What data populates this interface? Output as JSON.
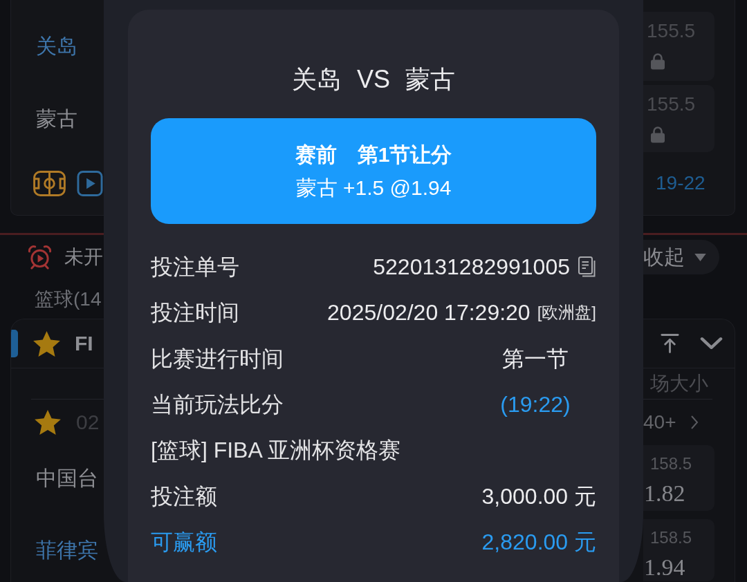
{
  "background": {
    "match": {
      "teams": [
        {
          "name": "关岛",
          "highlighted": true,
          "line": "155.5",
          "locked": true
        },
        {
          "name": "蒙古",
          "highlighted": false,
          "line": "155.5",
          "locked": true
        }
      ],
      "score": "19-22"
    },
    "status_bar": {
      "label": "未开",
      "collapse_button": "收起"
    },
    "section_title": "篮球(14",
    "league": {
      "name": "FI",
      "starred": true,
      "market": "场大小",
      "match": {
        "starred": true,
        "date": "02",
        "more": "40+",
        "teams": [
          {
            "name": "中国台",
            "highlighted": false,
            "line": "158.5",
            "odds": "1.82"
          },
          {
            "name": "菲律宾",
            "highlighted": true,
            "line": "158.5",
            "odds": "1.94"
          }
        ]
      }
    }
  },
  "bet_slip": {
    "title": "关岛 VS 蒙古",
    "selection": {
      "phase": "赛前",
      "market": "第1节让分",
      "pick": "蒙古 +1.5 @1.94"
    },
    "rows": [
      {
        "kind": "id",
        "label": "投注单号",
        "value": "5220131282991005"
      },
      {
        "kind": "time",
        "label": "投注时间",
        "value": "2025/02/20 17:29:20",
        "note": "[欧洲盘]"
      },
      {
        "kind": "status",
        "label": "比赛进行时间",
        "value": "第一节"
      },
      {
        "kind": "score",
        "label": "当前玩法比分",
        "value": "(19:22)"
      },
      {
        "kind": "league",
        "text": "[篮球] FIBA 亚洲杯资格赛"
      },
      {
        "kind": "amount",
        "label": "投注额",
        "value": "3,000.00 元"
      },
      {
        "kind": "payout",
        "label": "可赢额",
        "value": "2,820.00 元"
      }
    ]
  }
}
